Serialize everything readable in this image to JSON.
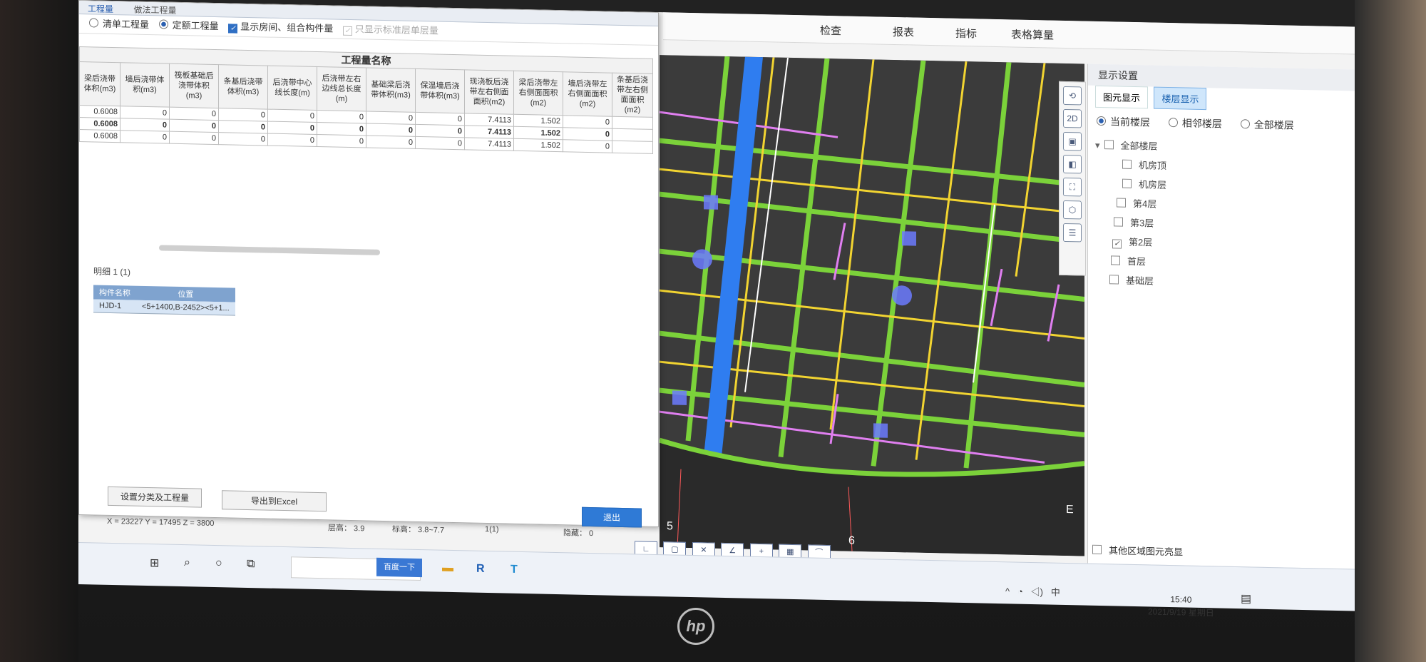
{
  "ribbon": {
    "tabs": [
      "检查",
      "报表",
      "指标",
      "表格算量"
    ]
  },
  "dialog": {
    "tabs": [
      "工程量",
      "做法工程量"
    ],
    "options": {
      "list_quantity": "清单工程量",
      "quota_quantity": "定额工程量",
      "show_room": "显示房间、组合构件量",
      "only_standard": "只显示标准层单层量"
    },
    "group_header": "工程量名称",
    "columns": [
      "梁后浇带体积(m3)",
      "墙后浇带体积(m3)",
      "筏板基础后浇带体积(m3)",
      "条基后浇带体积(m3)",
      "后浇带中心线长度(m)",
      "后浇带左右边线总长度(m)",
      "基础梁后浇带体积(m3)",
      "保温墙后浇带体积(m3)",
      "现浇板后浇带左右侧面面积(m2)",
      "梁后浇带左右侧面面积(m2)",
      "墙后浇带左右侧面面积(m2)",
      "条基后浇带左右侧面面积(m2)"
    ],
    "rows": [
      [
        "0.6008",
        "0",
        "0",
        "0",
        "0",
        "0",
        "0",
        "0",
        "7.4113",
        "1.502",
        "0",
        ""
      ],
      [
        "0.6008",
        "0",
        "0",
        "0",
        "0",
        "0",
        "0",
        "0",
        "7.4113",
        "1.502",
        "0",
        ""
      ],
      [
        "0.6008",
        "0",
        "0",
        "0",
        "0",
        "0",
        "0",
        "0",
        "7.4113",
        "1.502",
        "0",
        ""
      ]
    ],
    "detail_header": "明细  1 (1)",
    "detail_columns": [
      "构件名称",
      "位置"
    ],
    "detail_rows": [
      [
        "HJD-1",
        "<5+1400,B-2452><5+1..."
      ]
    ],
    "buttons": {
      "set_category": "设置分类及工程量",
      "export_excel": "导出到Excel",
      "exit": "退出"
    }
  },
  "statusbar": {
    "coords": "X = 23227 Y = 17495 Z = 3800",
    "floor_height": "层高：  3.9",
    "elevation": "标高：  3.8~7.7",
    "count": "1(1)",
    "hidden": "隐藏：  0"
  },
  "viewport": {
    "axis_labels": [
      "5",
      "6",
      "E"
    ]
  },
  "display_settings": {
    "title": "显示设置",
    "tabs": [
      "图元显示",
      "楼层显示"
    ],
    "radios": [
      "当前楼层",
      "相邻楼层",
      "全部楼层"
    ],
    "floors": [
      {
        "label": "全部楼层",
        "checked": false
      },
      {
        "label": "机房顶",
        "checked": false
      },
      {
        "label": "机房层",
        "checked": false
      },
      {
        "label": "第4层",
        "checked": false
      },
      {
        "label": "第3层",
        "checked": false
      },
      {
        "label": "第2层",
        "checked": true
      },
      {
        "label": "首层",
        "checked": false
      },
      {
        "label": "基础层",
        "checked": false
      }
    ],
    "other_region": "其他区域图元亮显"
  },
  "taskbar": {
    "search_button": "百度一下",
    "time": "15:40",
    "date": "2021/9/19 星期日"
  },
  "colors": {
    "accent": "#2f7ad6",
    "beam_green": "#7bd23a",
    "slab_yellow": "#f2d431",
    "band_blue": "#2f7df0",
    "pink": "#e07ff0"
  }
}
